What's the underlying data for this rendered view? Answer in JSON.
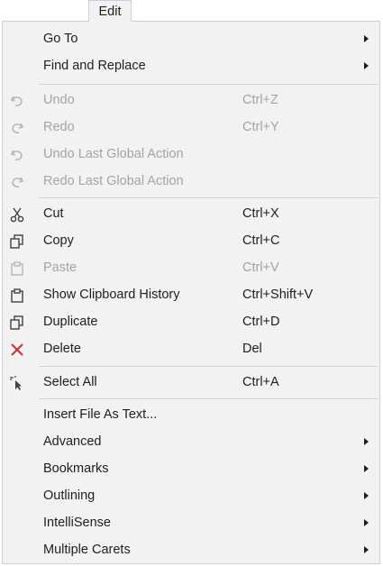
{
  "menu_bar": {
    "edit_label": "Edit"
  },
  "menu": {
    "goto": {
      "label": "Go To"
    },
    "find_replace": {
      "label": "Find and Replace"
    },
    "undo": {
      "label": "Undo",
      "shortcut": "Ctrl+Z",
      "icon": "undo-icon"
    },
    "redo": {
      "label": "Redo",
      "shortcut": "Ctrl+Y",
      "icon": "redo-icon"
    },
    "undo_global": {
      "label": "Undo Last Global Action",
      "icon": "undo-icon"
    },
    "redo_global": {
      "label": "Redo Last Global Action",
      "icon": "redo-icon"
    },
    "cut": {
      "label": "Cut",
      "shortcut": "Ctrl+X",
      "icon": "scissors-icon"
    },
    "copy": {
      "label": "Copy",
      "shortcut": "Ctrl+C",
      "icon": "copy-icon"
    },
    "paste": {
      "label": "Paste",
      "shortcut": "Ctrl+V",
      "icon": "clipboard-icon"
    },
    "clipboard_history": {
      "label": "Show Clipboard History",
      "shortcut": "Ctrl+Shift+V",
      "icon": "clipboard-icon"
    },
    "duplicate": {
      "label": "Duplicate",
      "shortcut": "Ctrl+D",
      "icon": "copy-icon"
    },
    "delete": {
      "label": "Delete",
      "shortcut": "Del",
      "icon": "red-x-icon"
    },
    "select_all": {
      "label": "Select All",
      "shortcut": "Ctrl+A",
      "icon": "select-all-icon"
    },
    "insert_file": {
      "label": "Insert File As Text..."
    },
    "advanced": {
      "label": "Advanced"
    },
    "bookmarks": {
      "label": "Bookmarks"
    },
    "outlining": {
      "label": "Outlining"
    },
    "intellisense": {
      "label": "IntelliSense"
    },
    "multiple_carets": {
      "label": "Multiple Carets"
    }
  },
  "colors": {
    "menu_background": "#f2f2f2",
    "separator": "#cccedb",
    "text": "#1e1e1e",
    "disabled_text": "#a2a4a5",
    "delete_icon": "#c5322f"
  }
}
